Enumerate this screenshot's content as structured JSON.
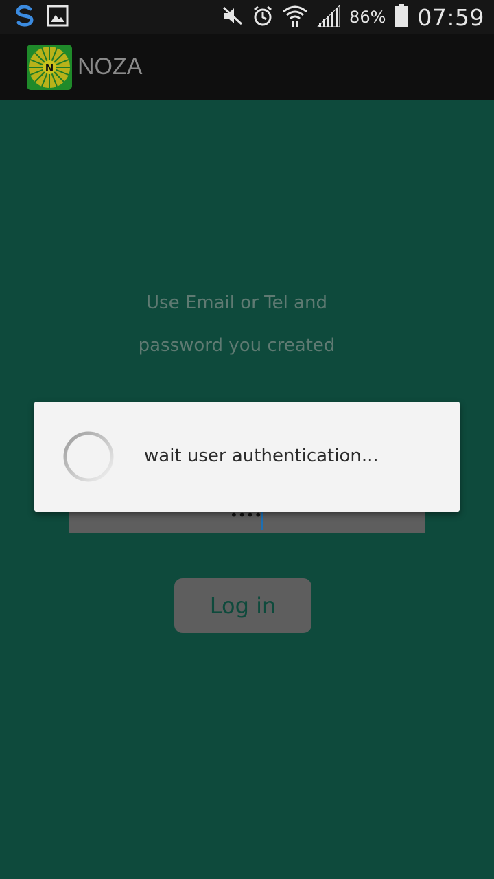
{
  "status_bar": {
    "battery_percent": "86%",
    "battery_level": 0.86,
    "time": "07:59",
    "icons": [
      "swype-s-icon",
      "image-notification-icon",
      "mute-icon",
      "alarm-icon",
      "wifi-icon",
      "signal-icon",
      "battery-icon"
    ]
  },
  "action_bar": {
    "title": "NOZA",
    "logo_letter": "N"
  },
  "login": {
    "hint_line1": "Use Email or Tel  and",
    "hint_line2": "password you created",
    "password_mask": "••••",
    "button_label": "Log in"
  },
  "dialog": {
    "message": "wait user authentication..."
  },
  "colors": {
    "background": "#0e4a3c",
    "action_bar": "#0f0f0f",
    "dialog": "#f3f3f3"
  }
}
